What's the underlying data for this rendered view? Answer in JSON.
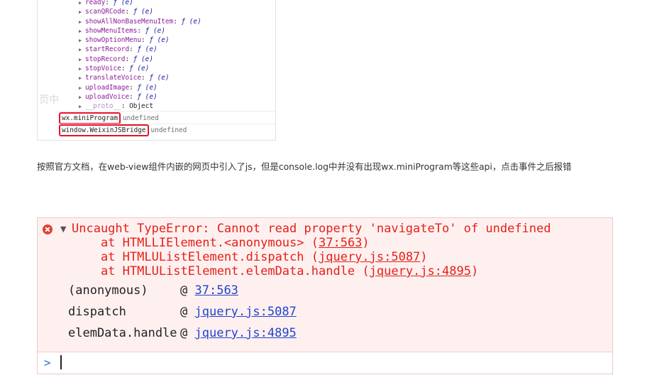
{
  "devtools_listing": {
    "ghost_text": "页中",
    "properties": [
      {
        "key": "ready",
        "value": "ƒ (e)"
      },
      {
        "key": "scanQRCode",
        "value": "ƒ (e)"
      },
      {
        "key": "showAllNonBaseMenuItem",
        "value": "ƒ (e)"
      },
      {
        "key": "showMenuItems",
        "value": "ƒ (e)"
      },
      {
        "key": "showOptionMenu",
        "value": "ƒ (e)"
      },
      {
        "key": "startRecord",
        "value": "ƒ (e)"
      },
      {
        "key": "stopRecord",
        "value": "ƒ (e)"
      },
      {
        "key": "stopVoice",
        "value": "ƒ (e)"
      },
      {
        "key": "translateVoice",
        "value": "ƒ (e)"
      },
      {
        "key": "uploadImage",
        "value": "ƒ (e)"
      },
      {
        "key": "uploadVoice",
        "value": "ƒ (e)"
      },
      {
        "key": "__proto__",
        "value": "Object"
      }
    ],
    "evaluations": [
      {
        "expression": "wx.miniProgram",
        "result": "undefined"
      },
      {
        "expression": "window.WeixinJSBridge",
        "result": "undefined"
      }
    ]
  },
  "paragraph": "按照官方文档，在web-view组件内嵌的网页中引入了js，但是console.log中并没有出现wx.miniProgram等这些api，点击事件之后报错",
  "console": {
    "error_message": "Uncaught TypeError: Cannot read property 'navigateTo' of undefined",
    "trace": [
      {
        "prefix": "    at HTMLLIElement.<anonymous> (",
        "link": "37:563",
        "suffix": ")"
      },
      {
        "prefix": "    at HTMLUListElement.dispatch (",
        "link": "jquery.js:5087",
        "suffix": ")"
      },
      {
        "prefix": "    at HTMLUListElement.elemData.handle (",
        "link": "jquery.js:4895",
        "suffix": ")"
      }
    ],
    "stack": [
      {
        "fn": "(anonymous)",
        "at": "@",
        "link": "37:563"
      },
      {
        "fn": "dispatch",
        "at": "@",
        "link": "jquery.js:5087"
      },
      {
        "fn": "elemData.handle",
        "at": "@",
        "link": "jquery.js:4895"
      }
    ],
    "prompt_symbol": ">",
    "input_value": ""
  },
  "colors": {
    "error_red": "#e32118",
    "error_background": "#fff0f0",
    "link_blue": "#2244cc",
    "highlight_box": "#e3142b"
  },
  "icons": [
    "error-circle-icon",
    "expand-triangle-icon",
    "console-prompt-icon"
  ]
}
